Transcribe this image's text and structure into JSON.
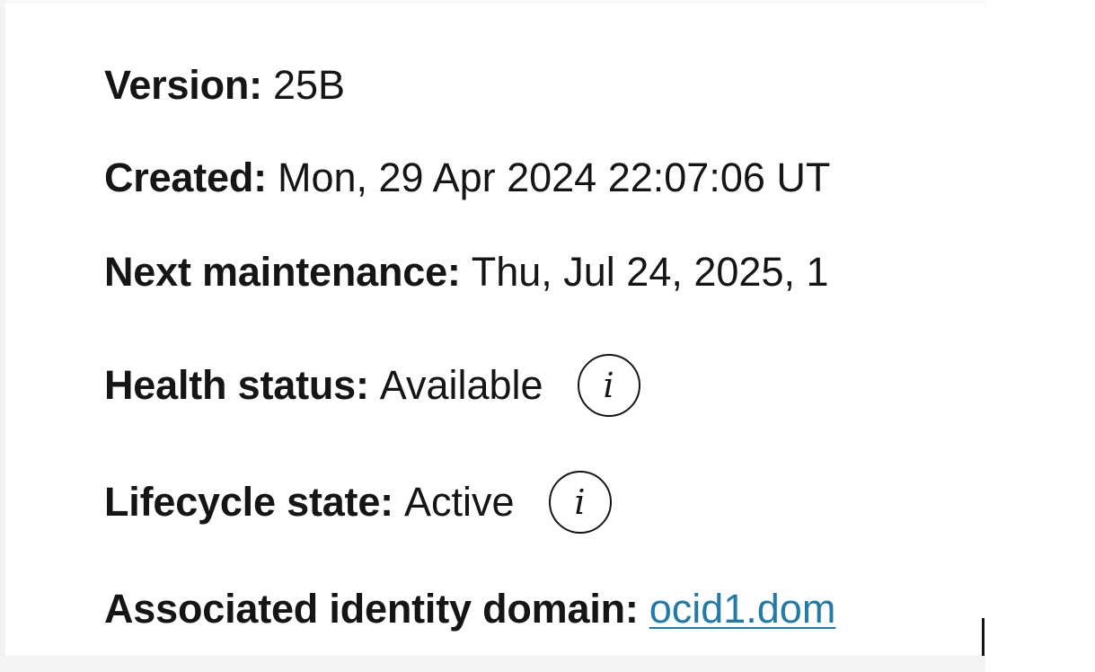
{
  "details": {
    "version": {
      "label": "Version:",
      "value": "25B"
    },
    "created": {
      "label": "Created:",
      "value": "Mon, 29 Apr 2024 22:07:06 UT"
    },
    "next_maintenance": {
      "label": "Next maintenance:",
      "value": "Thu, Jul 24, 2025, 1"
    },
    "health_status": {
      "label": "Health status:",
      "value": "Available",
      "info_icon": "info-icon"
    },
    "lifecycle_state": {
      "label": "Lifecycle state:",
      "value": "Active",
      "info_icon": "info-icon"
    },
    "identity_domain": {
      "label": "Associated identity domain:",
      "link": "ocid1.dom"
    }
  },
  "colors": {
    "text": "#161513",
    "link": "#227aa5",
    "background": "#ffffff"
  }
}
